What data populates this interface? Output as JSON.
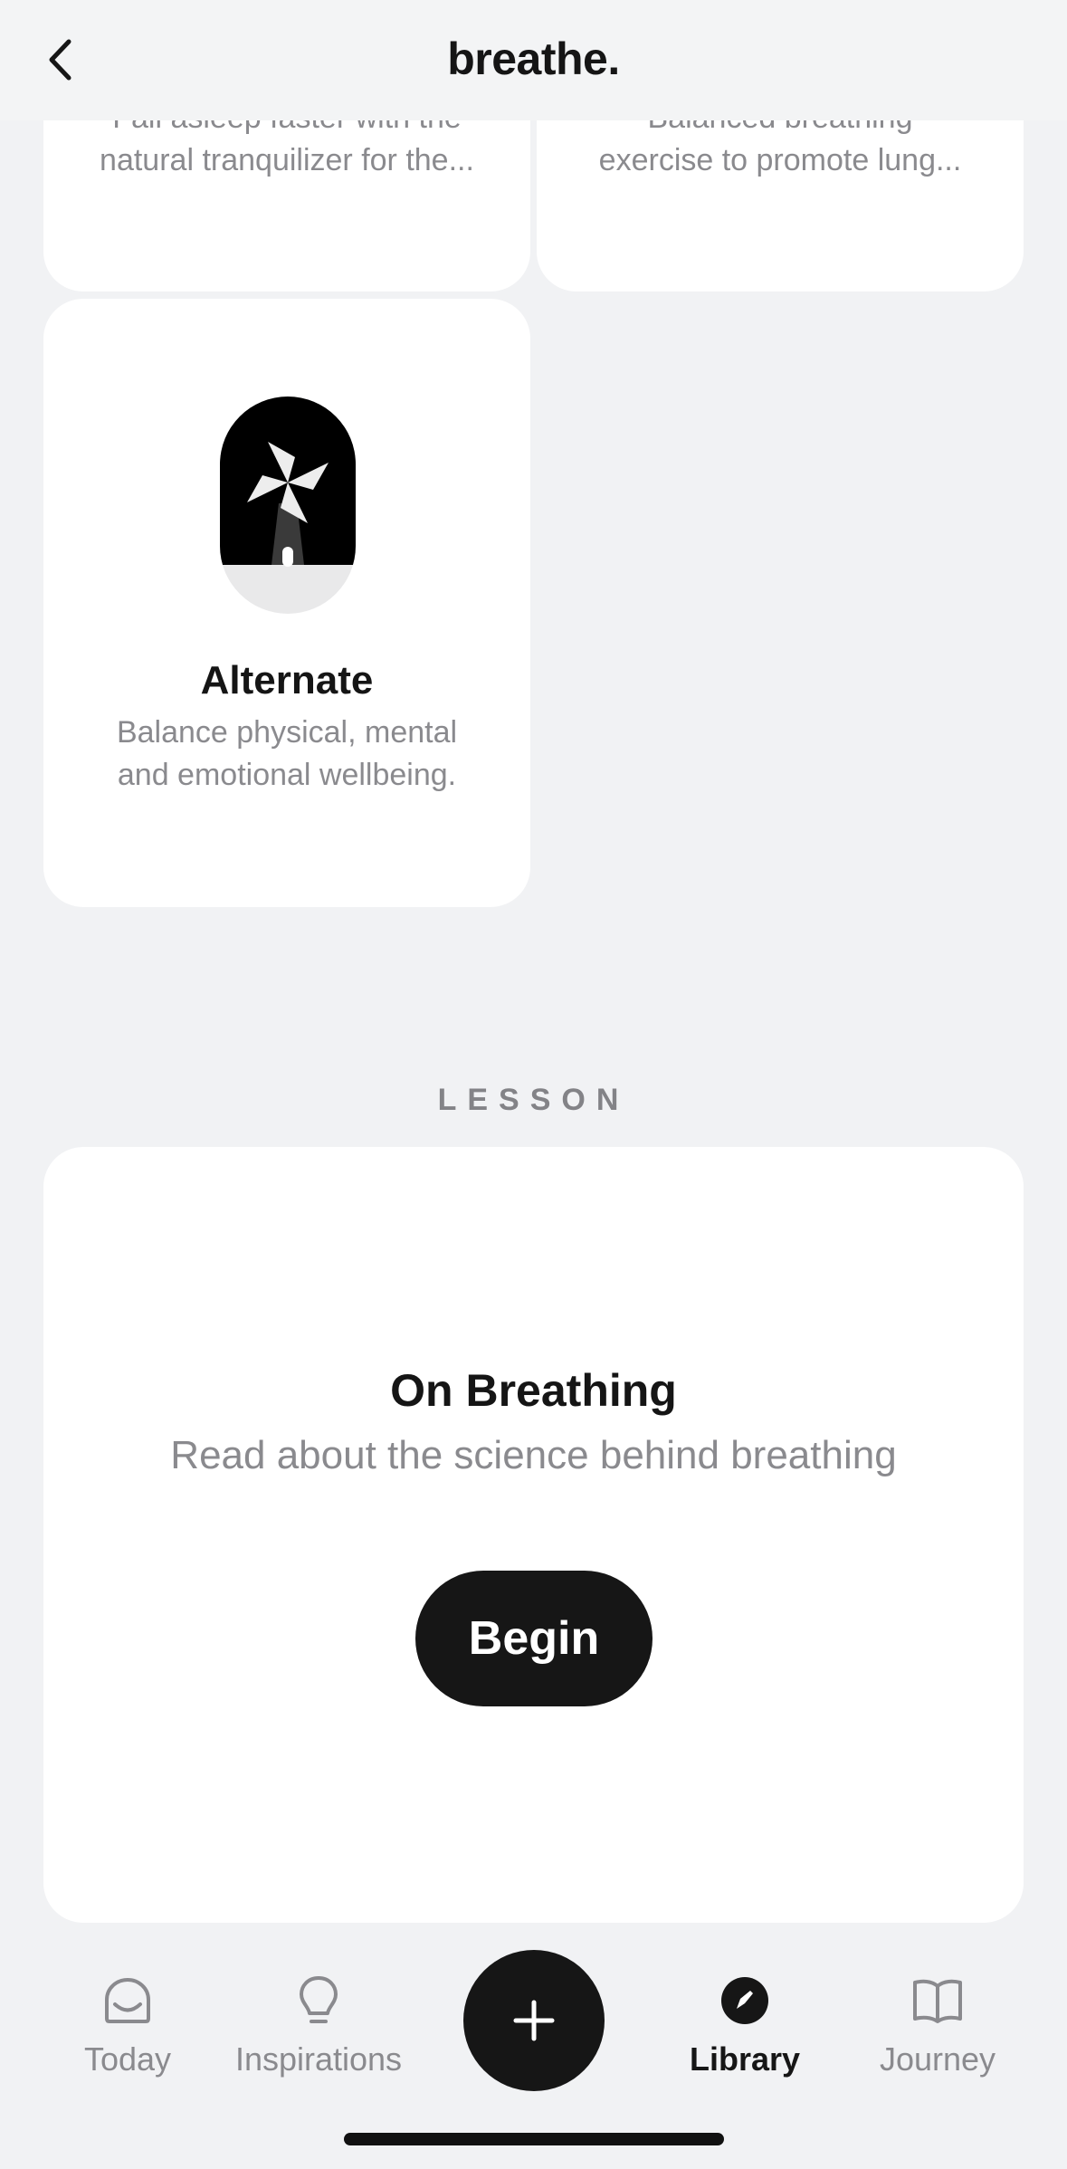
{
  "header": {
    "title": "breathe."
  },
  "cards": [
    {
      "title": "",
      "description_line1": "Fall asleep faster with the",
      "description_line2": "natural tranquilizer for the..."
    },
    {
      "title": "",
      "description_line1": "Balanced breathing",
      "description_line2": "exercise to promote lung..."
    },
    {
      "title": "Alternate",
      "description_line1": "Balance physical, mental",
      "description_line2": "and emotional wellbeing.",
      "icon": "pinwheel-icon"
    }
  ],
  "lesson": {
    "section_label": "LESSON",
    "title": "On Breathing",
    "subtitle": "Read about the science behind breathing",
    "button_label": "Begin"
  },
  "tabbar": {
    "items": [
      {
        "label": "Today",
        "icon": "home-icon",
        "active": false
      },
      {
        "label": "Inspirations",
        "icon": "lightbulb-icon",
        "active": false
      },
      {
        "label": "Library",
        "icon": "compass-icon",
        "active": true
      },
      {
        "label": "Journey",
        "icon": "book-icon",
        "active": false
      }
    ],
    "fab_icon": "plus-icon"
  },
  "colors": {
    "background": "#f1f2f4",
    "card": "#ffffff",
    "primary": "#161616",
    "muted": "#8a8a8e"
  }
}
